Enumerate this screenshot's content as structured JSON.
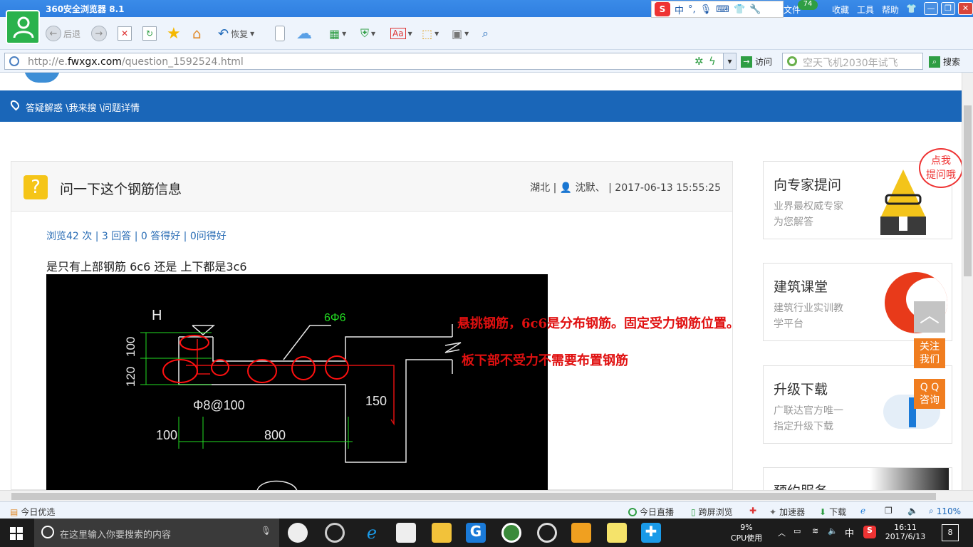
{
  "browser": {
    "title": "360安全浏览器 8.1",
    "menu": [
      "文件",
      "收藏",
      "工具",
      "帮助"
    ],
    "badge": "74",
    "toolbar": {
      "back": "后退",
      "restore": "恢复"
    },
    "url_prefix": "http://e.",
    "url_domain": "fwxgx.com",
    "url_path": "/question_1592524.html",
    "visit_label": "访问",
    "search_placeholder": "空天飞机2030年试飞",
    "search_label": "搜索"
  },
  "ime": {
    "mode": "中"
  },
  "page": {
    "breadcrumb": "答疑解惑 \\我来搜 \\问题详情",
    "question": {
      "title": "问一下这个钢筋信息",
      "meta_location": "湖北 |",
      "meta_user": "沈默、",
      "meta_date": "| 2017-06-13 15:55:25",
      "stats": "浏览42 次 | 3 回答 | 0 答得好 | 0问得好",
      "body": "是只有上部钢筋  6c6  还是  上下都是3c6"
    },
    "annotation_1": "悬挑钢筋，6c6是分布钢筋。固定受力钢筋位置。",
    "annotation_2": "板下部不受力不需要布置钢筋",
    "cad_labels": {
      "h": "H",
      "top_bar": "6Φ6",
      "dim_100": "100",
      "dim_120": "120",
      "stirrup": "Φ8@100",
      "dim_150": "150",
      "dim_100b": "100",
      "dim_800": "800"
    },
    "sidebar": {
      "ask": {
        "title": "向专家提问",
        "sub1": "业界最权威专家",
        "sub2": "为您解答",
        "bubble1": "点我",
        "bubble2": "提问哦"
      },
      "course": {
        "title": "建筑课堂",
        "sub1": "建筑行业实训教",
        "sub2": "学平台"
      },
      "upgrade": {
        "title": "升级下载",
        "sub1": "广联达官方唯一",
        "sub2": "指定升级下载"
      },
      "reserve": {
        "title": "预约服务"
      }
    },
    "float": {
      "follow1": "关注",
      "follow2": "我们",
      "qq1": "Q Q",
      "qq2": "咨询"
    }
  },
  "statusbar": {
    "today_pick": "今日优选",
    "live": "今日直播",
    "cross": "跨屏浏览",
    "accel": "加速器",
    "download": "下载",
    "zoom": "110%"
  },
  "taskbar": {
    "search_placeholder": "在这里输入你要搜索的内容",
    "cpu_pct": "9%",
    "cpu_label": "CPU使用",
    "ime": "中",
    "time": "16:11",
    "date": "2017/6/13",
    "notif": "8"
  }
}
